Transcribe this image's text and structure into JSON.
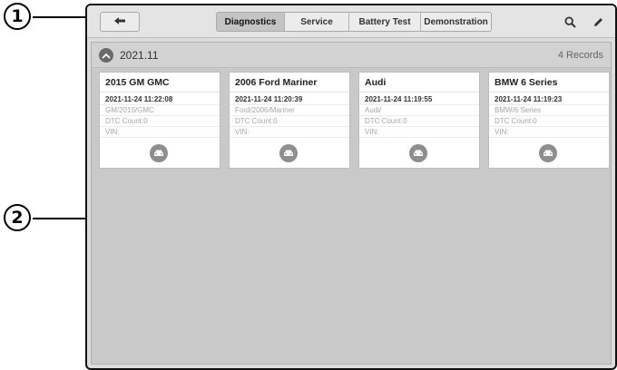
{
  "callouts": [
    "1",
    "2"
  ],
  "toolbar": {
    "back_icon": "back-arrow-icon",
    "tabs": [
      {
        "label": "Diagnostics",
        "active": true
      },
      {
        "label": "Service",
        "active": false
      },
      {
        "label": "Battery Test",
        "active": false
      },
      {
        "label": "Demonstration",
        "active": false
      }
    ],
    "search_icon": "search-icon",
    "edit_icon": "edit-pencil-icon"
  },
  "group": {
    "date": "2021.11",
    "count": "4 Records"
  },
  "records": [
    {
      "title": "2015 GM GMC",
      "timestamp": "2021-11-24 11:22:08",
      "path": "GM/2015/GMC",
      "dtc": "DTC Count:0",
      "vin": "VIN:"
    },
    {
      "title": "2006 Ford Mariner",
      "timestamp": "2021-11-24 11:20:39",
      "path": "Ford/2006/Mariner",
      "dtc": "DTC Count:0",
      "vin": "VIN:"
    },
    {
      "title": "Audi",
      "timestamp": "2021-11-24 11:19:55",
      "path": "Audi/",
      "dtc": "DTC Count:0",
      "vin": "VIN:"
    },
    {
      "title": "BMW 6 Series",
      "timestamp": "2021-11-24 11:19:23",
      "path": "BMW/6 Series",
      "dtc": "DTC Count:0",
      "vin": "VIN:"
    }
  ],
  "colors": {
    "active_tab": "#c4c4c4",
    "content_bg": "#c9c9c9",
    "icon_circle": "#8e8e8e"
  }
}
